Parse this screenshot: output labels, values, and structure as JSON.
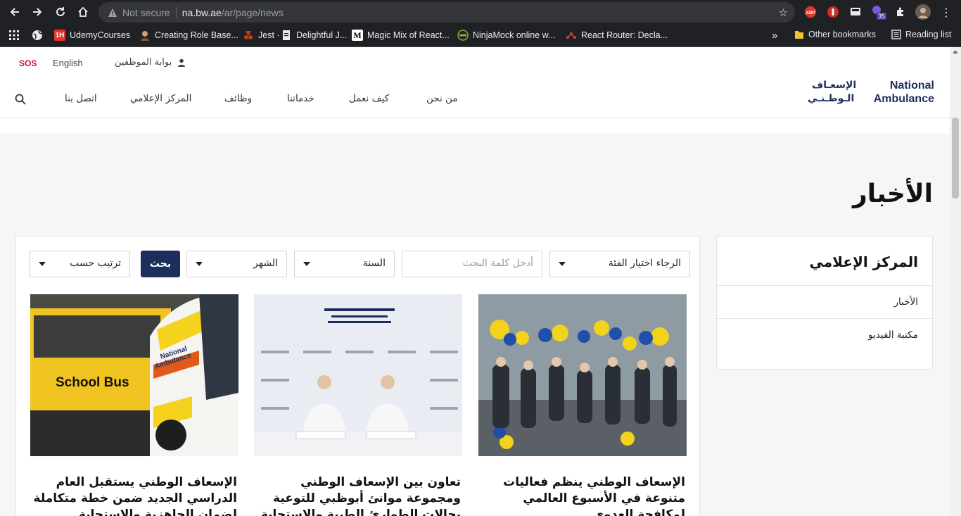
{
  "browser": {
    "security_label": "Not secure",
    "url_host": "na.bw.ae",
    "url_path": "/ar/page/news",
    "extension_badge": "35",
    "abp_label": "ABP"
  },
  "bookmarks": {
    "items": [
      {
        "icon": "1H",
        "label": "UdemyCourses"
      },
      {
        "icon": "avatar",
        "label": "Creating Role Base..."
      },
      {
        "icon": "jest",
        "label": "Jest ·"
      },
      {
        "icon": "doc",
        "label": "Delightful J..."
      },
      {
        "icon": "M",
        "label": "Magic Mix of React..."
      },
      {
        "icon": "eye",
        "label": "NinjaMock online w..."
      },
      {
        "icon": "router",
        "label": "React Router: Decla..."
      }
    ],
    "more": "»",
    "other": "Other bookmarks",
    "reading": "Reading list"
  },
  "header": {
    "sos": "SOS",
    "language": "English",
    "employee_portal": "بوابة الموظفين",
    "logo_en_1": "National",
    "logo_en_2": "Ambulance",
    "logo_ar_1": "الإسعـاف",
    "logo_ar_2": "الـوطـنـي"
  },
  "nav": {
    "about": "من نحن",
    "how": "كيف نعمل",
    "services": "خدماتنا",
    "jobs": "وظائف",
    "media": "المركز الإعلامي",
    "contact": "اتصل بنا"
  },
  "page": {
    "title": "الأخبار"
  },
  "sidebar": {
    "title": "المركز الإعلامي",
    "items": [
      "الأخبار",
      "مكتبة الفيديو"
    ]
  },
  "filters": {
    "category": "الرجاء اختيار الفئة",
    "keyword_placeholder": "أدخل كلمة البحث",
    "year": "السنة",
    "month": "الشهر",
    "search_button": "بحث",
    "sort": "ترتيب حسب"
  },
  "news": [
    {
      "title": "الإسعاف الوطني ينظم فعاليات متنوعة في الأسبوع العالمي لمكافحة العدوى"
    },
    {
      "title": "تعاون بين الإسعاف الوطني ومجموعة موانئ أبوظبي للتوعية بحالات الطوارئ الطبية والاستجابة"
    },
    {
      "title": "الإسعاف الوطني يستقبل العام الدراسي الجديد ضمن خطة متكاملة لضمان الجاهزية والاستجابة"
    }
  ],
  "images": {
    "bus_text": "School Bus",
    "van_text_1": "National",
    "van_text_2": "Ambulance"
  }
}
